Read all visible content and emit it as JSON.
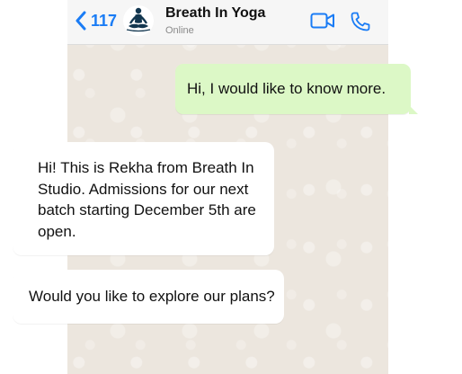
{
  "header": {
    "back_count": "117",
    "contact_name": "Breath In Yoga",
    "contact_status": "Online",
    "icons": [
      "chevron-left-icon",
      "yoga-meditation-avatar",
      "video-camera-icon",
      "phone-icon"
    ],
    "accent_color": "#1a7cf5"
  },
  "messages": [
    {
      "direction": "outgoing",
      "text": "Hi, I would like to know more."
    },
    {
      "direction": "incoming",
      "text": "Hi! This is Rekha from Breath In Studio. Admissions for our next batch starting December 5th are open."
    },
    {
      "direction": "incoming",
      "text": "Would you like to explore our plans?"
    }
  ],
  "colors": {
    "outgoing_bubble": "#dcf8c6",
    "incoming_bubble": "#ffffff",
    "chat_background": "#ece6de"
  }
}
